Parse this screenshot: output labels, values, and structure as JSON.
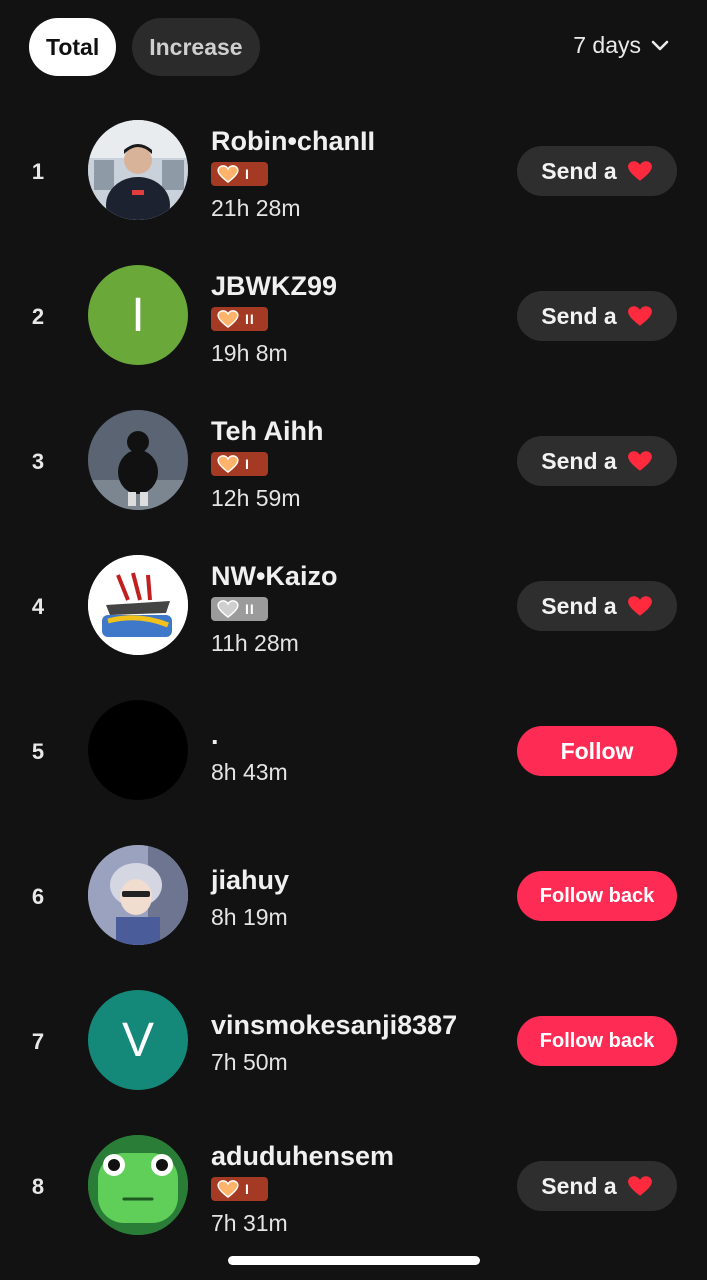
{
  "tabs": {
    "total": "Total",
    "increase": "Increase"
  },
  "range": {
    "label": "7 days"
  },
  "colors": {
    "accent": "#fe2c55",
    "badge_orange": "#a43a23",
    "badge_gray": "#9b9b9b"
  },
  "rows": [
    {
      "rank": "1",
      "name": "Robin•chanII",
      "badge": "I",
      "badge_color": "orange",
      "time": "21h 28m",
      "action": "Send a",
      "action_type": "send",
      "avatar": "photo-man-hoodie"
    },
    {
      "rank": "2",
      "name": "JBWKZ99",
      "badge": "II",
      "badge_color": "orange",
      "time": "19h 8m",
      "action": "Send a",
      "action_type": "send",
      "avatar": "letter",
      "avatar_letter": "I",
      "avatar_color": "#6aa83a"
    },
    {
      "rank": "3",
      "name": "Teh Aihh",
      "badge": "I",
      "badge_color": "orange",
      "time": "12h 59m",
      "action": "Send a",
      "action_type": "send",
      "avatar": "photo-person-dark"
    },
    {
      "rank": "4",
      "name": "NW•Kaizo",
      "badge": "II",
      "badge_color": "gray",
      "time": "11h 28m",
      "action": "Send a",
      "action_type": "send",
      "avatar": "logo-graffiti"
    },
    {
      "rank": "5",
      "name": ".",
      "time": "8h 43m",
      "action": "Follow",
      "action_type": "follow",
      "avatar": "black"
    },
    {
      "rank": "6",
      "name": "jiahuy",
      "time": "8h 19m",
      "action": "Follow back",
      "action_type": "followback",
      "avatar": "photo-anime-character"
    },
    {
      "rank": "7",
      "name": "vinsmokesanji8387",
      "time": "7h 50m",
      "action": "Follow back",
      "action_type": "followback",
      "avatar": "letter",
      "avatar_letter": "V",
      "avatar_color": "#14897a"
    },
    {
      "rank": "8",
      "name": "aduduhensem",
      "badge": "I",
      "badge_color": "orange",
      "time": "7h 31m",
      "action": "Send a",
      "action_type": "send",
      "avatar": "photo-green-character"
    }
  ]
}
